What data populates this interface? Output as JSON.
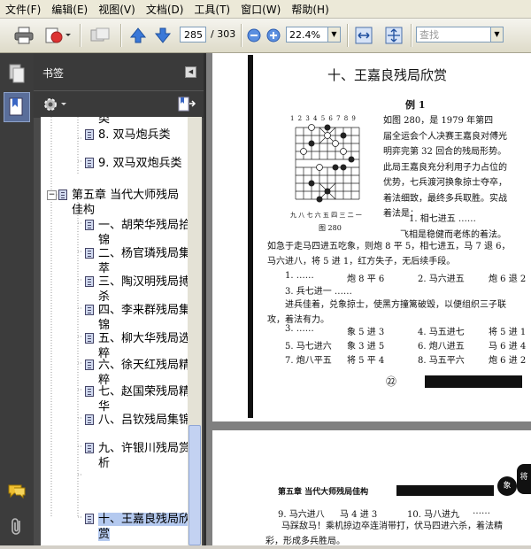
{
  "menu": [
    {
      "label": "文件(F)"
    },
    {
      "label": "编辑(E)"
    },
    {
      "label": "视图(V)"
    },
    {
      "label": "文档(D)"
    },
    {
      "label": "工具(T)"
    },
    {
      "label": "窗口(W)"
    },
    {
      "label": "帮助(H)"
    }
  ],
  "toolbar": {
    "page_current": "285",
    "page_total": "/ 303",
    "zoom": "22.4%",
    "search_placeholder": "查找"
  },
  "bookmarks": {
    "title": "书签",
    "items": [
      {
        "label": "类",
        "indent": 2
      },
      {
        "label": "8.  双马炮兵类",
        "indent": 2
      },
      {
        "label": "9.  双马双炮兵类",
        "indent": 2
      },
      {
        "label": "第五章  当代大师残局佳构",
        "indent": 1
      },
      {
        "label": "一、胡荣华残局拾锦",
        "indent": 2
      },
      {
        "label": "二、杨官璘残局集萃",
        "indent": 2
      },
      {
        "label": "三、陶汉明残局搏杀",
        "indent": 2
      },
      {
        "label": "四、李来群残局集锦",
        "indent": 2
      },
      {
        "label": "五、柳大华残局选粹",
        "indent": 2
      },
      {
        "label": "六、徐天红残局精粹",
        "indent": 2
      },
      {
        "label": "七、赵国荣残局精华",
        "indent": 2
      },
      {
        "label": "八、吕钦残局集锦",
        "indent": 2
      },
      {
        "label": "九、许银川残局赏析",
        "indent": 2
      },
      {
        "label": "十、王嘉良残局欣赏",
        "indent": 2,
        "selected": true
      }
    ]
  },
  "document": {
    "page1": {
      "title": "十、王嘉良残局欣赏",
      "example": "例 1",
      "para1": [
        "如图 280，是 1979 年第四",
        "届全运会个人决赛王嘉良对傅光",
        "明弈完第 32 回合的残局形势。",
        "此局王嘉良充分利用子力占位的",
        "优势，七兵渡河换象掠士夺卒，",
        "着法细致，最终多兵取胜。实战",
        "着法是："
      ],
      "board_numbers_top": "1 2 3 4 5 6 7 8 9",
      "board_numbers_bottom": "九 八 七 六 五 四 三 二 一",
      "figure_caption": "图 280",
      "move1": "1. 相七进五    ……",
      "comment1": "飞相是稳健而老练的着法。",
      "para2": [
        "如急于走马四进五吃象，则炮 8 平 5，相七进五，马 7 退 6，",
        "马六进八，将 5 进 1，红方失子，无后续手段。"
      ],
      "moves_a": [
        "1. ……",
        "炮 8 平 6",
        "2. 马六进五",
        "炮 6 退 2"
      ],
      "move3": "3. 兵七进一    ……",
      "para3": [
        "进兵佳着，兑象掠士，使黑方撞篱破毁，以便组织三子联",
        "攻，着法有力。"
      ],
      "moves_b": [
        [
          "3. ……",
          "象 5 进 3",
          "4. 马五进七",
          "将 5 进 1"
        ],
        [
          "5. 马七进六",
          "象 3 进 5",
          "6. 炮八进五",
          "马 6 进 4"
        ],
        [
          "7. 炮八平五",
          "将 5 平 4",
          "8. 马五平六",
          "炮 6 进 2"
        ]
      ],
      "page_number": "㉒"
    },
    "page2": {
      "header": "第五章    当代大师残局佳构",
      "moves": [
        "9. 马六进八",
        "马 4 进 3",
        "10. 马八进九",
        "……"
      ],
      "text": [
        "马踩敌马！乘机掠边卒连消带打，伏马四进六杀，着法精",
        "彩，形成多兵胜局。"
      ],
      "side_char": "象",
      "corner_char": "将"
    }
  },
  "colors": {
    "bookmark_selected": "#b4c9ef",
    "panel_bg": "#4a4a4a",
    "nav_strip": "#3c3c3c"
  }
}
